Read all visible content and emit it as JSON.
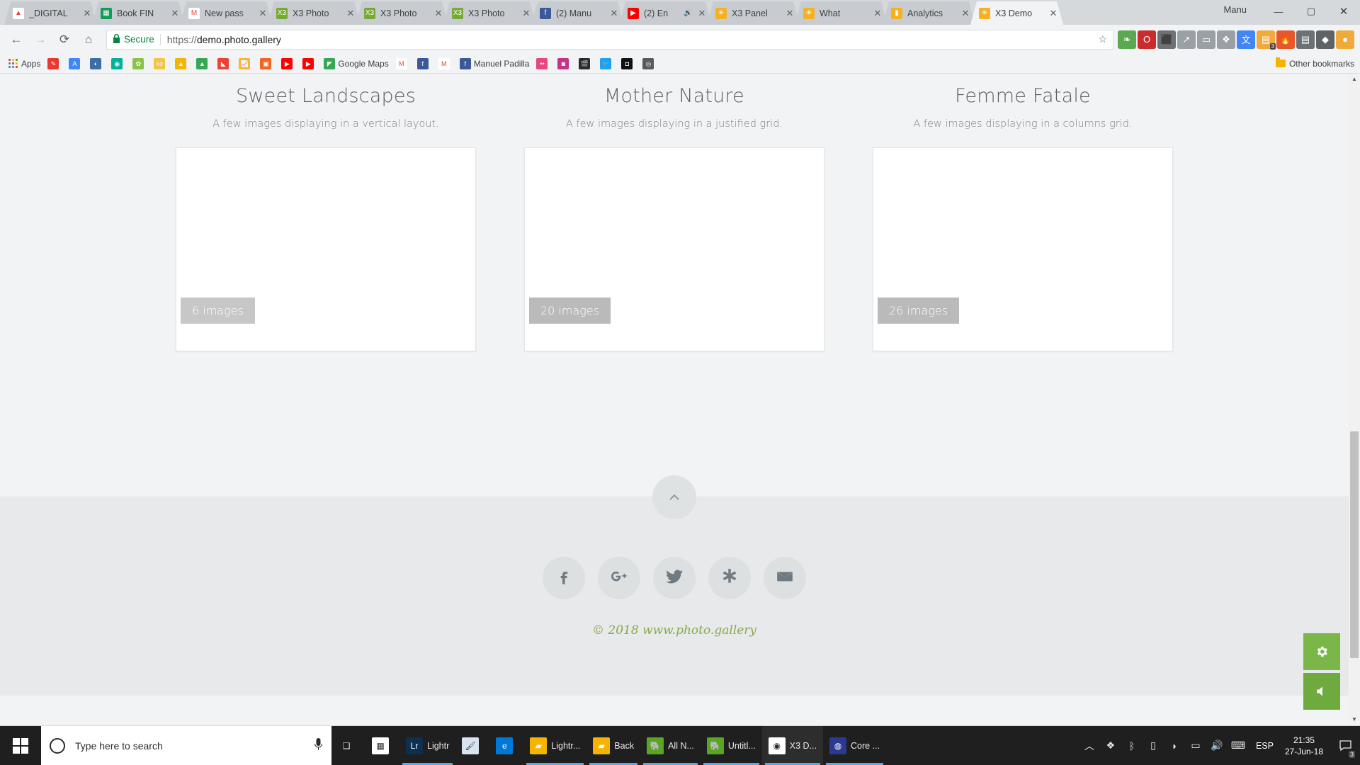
{
  "browser": {
    "tabs": [
      {
        "title": "_DIGITAL",
        "favicon": "drive-icon",
        "color": "#ffffff",
        "glyph": "▲",
        "active": false,
        "audio": false
      },
      {
        "title": "Book FIN",
        "favicon": "sheets-icon",
        "color": "#0f9d58",
        "glyph": "▦",
        "active": false,
        "audio": false
      },
      {
        "title": "New pass",
        "favicon": "gmail-icon",
        "color": "#ffffff",
        "glyph": "M",
        "active": false,
        "audio": false
      },
      {
        "title": "X3 Photo",
        "favicon": "x3-icon",
        "color": "#76a935",
        "glyph": "X3",
        "active": false,
        "audio": false
      },
      {
        "title": "X3 Photo",
        "favicon": "x3-icon",
        "color": "#76a935",
        "glyph": "X3",
        "active": false,
        "audio": false
      },
      {
        "title": "X3 Photo",
        "favicon": "x3-icon",
        "color": "#76a935",
        "glyph": "X3",
        "active": false,
        "audio": false
      },
      {
        "title": "(2) Manu",
        "favicon": "facebook-icon",
        "color": "#3b5998",
        "glyph": "f",
        "active": false,
        "audio": false
      },
      {
        "title": "(2) En",
        "favicon": "youtube-icon",
        "color": "#ff0000",
        "glyph": "▶",
        "active": false,
        "audio": true
      },
      {
        "title": "X3 Panel",
        "favicon": "star-icon",
        "color": "#f5b120",
        "glyph": "✳",
        "active": false,
        "audio": false
      },
      {
        "title": "What",
        "favicon": "star-icon",
        "color": "#f5b120",
        "glyph": "✳",
        "active": false,
        "audio": false
      },
      {
        "title": "Analytics",
        "favicon": "analytics-icon",
        "color": "#f5b120",
        "glyph": "▮",
        "active": false,
        "audio": false
      },
      {
        "title": "X3 Demo",
        "favicon": "star-icon",
        "color": "#f5b120",
        "glyph": "✳",
        "active": true,
        "audio": false
      }
    ],
    "tab_close_label": "✕",
    "tab_audio_label": "🔊",
    "user_chip": "Manu",
    "window_controls": {
      "minimize": "—",
      "maximize": "▢",
      "close": "✕"
    },
    "nav": {
      "back": "←",
      "forward": "→",
      "reload": "⟳",
      "home": "⌂"
    },
    "omnibox": {
      "lock": "🔒",
      "secure_label": "Secure",
      "url_scheme": "https://",
      "url_host": "demo.photo.gallery",
      "bookmark_star": "☆"
    },
    "extensions": [
      {
        "name": "leaf-extension",
        "color": "#5aa84f",
        "glyph": "❧"
      },
      {
        "name": "opera-extension",
        "color": "#cc2b2b",
        "glyph": "O"
      },
      {
        "name": "puzzle-extension",
        "color": "#6d7176",
        "glyph": "⬛"
      },
      {
        "name": "cursor-extension",
        "color": "#9aa0a6",
        "glyph": "↗"
      },
      {
        "name": "window-extension",
        "color": "#9aa0a6",
        "glyph": "▭"
      },
      {
        "name": "dropbox-extension",
        "color": "#9aa0a6",
        "glyph": "❖"
      },
      {
        "name": "translate-extension",
        "color": "#4285f4",
        "glyph": "文"
      },
      {
        "name": "notes-extension",
        "color": "#f2a93b",
        "glyph": "▤",
        "badge": "3"
      },
      {
        "name": "fire-extension",
        "color": "#e8562b",
        "glyph": "🔥"
      },
      {
        "name": "stack-extension",
        "color": "#6d7176",
        "glyph": "▤"
      },
      {
        "name": "drop-extension",
        "color": "#5f6368",
        "glyph": "◆"
      },
      {
        "name": "profile-extension",
        "color": "#f2a93b",
        "glyph": "●"
      }
    ],
    "bookmarks": {
      "apps_label": "Apps",
      "items": [
        {
          "label": "",
          "color": "#e8392f",
          "glyph": "✎"
        },
        {
          "label": "",
          "color": "#4285f4",
          "glyph": "A"
        },
        {
          "label": "",
          "color": "#3a6ea5",
          "glyph": "◐"
        },
        {
          "label": "",
          "color": "#00b398",
          "glyph": "◉"
        },
        {
          "label": "",
          "color": "#8bc34a",
          "glyph": "✿"
        },
        {
          "label": "",
          "color": "#f6c344",
          "glyph": "xe"
        },
        {
          "label": "",
          "color": "#f4b400",
          "glyph": "▲"
        },
        {
          "label": "",
          "color": "#34a853",
          "glyph": "▲"
        },
        {
          "label": "",
          "color": "#ea4335",
          "glyph": "◣"
        },
        {
          "label": "",
          "color": "#f7b733",
          "glyph": "📈"
        },
        {
          "label": "",
          "color": "#f26522",
          "glyph": "▣"
        },
        {
          "label": "",
          "color": "#ff0000",
          "glyph": "▶"
        },
        {
          "label": "",
          "color": "#ff0000",
          "glyph": "▶"
        },
        {
          "label": "Google Maps",
          "color": "#34a853",
          "glyph": "◤"
        },
        {
          "label": "",
          "color": "#ffffff",
          "glyph": "M"
        },
        {
          "label": "",
          "color": "#3b5998",
          "glyph": "f"
        },
        {
          "label": "",
          "color": "#ffffff",
          "glyph": "M"
        },
        {
          "label": "Manuel Padilla",
          "color": "#3b5998",
          "glyph": "f"
        },
        {
          "label": "",
          "color": "#e8467c",
          "glyph": "••"
        },
        {
          "label": "",
          "color": "#c13584",
          "glyph": "◙"
        },
        {
          "label": "",
          "color": "#2b2b2b",
          "glyph": "🎬"
        },
        {
          "label": "",
          "color": "#1da1f2",
          "glyph": "🐦"
        },
        {
          "label": "",
          "color": "#111111",
          "glyph": "◘"
        },
        {
          "label": "",
          "color": "#5a5a5a",
          "glyph": "◎"
        }
      ],
      "other_bookmarks": "Other bookmarks"
    }
  },
  "page": {
    "galleries": [
      {
        "title": "Sweet Landscapes",
        "subtitle": "A few images displaying in a vertical layout.",
        "count_label": "6 images",
        "thumb": "landscape-sunset-photo",
        "badge_style": "dark"
      },
      {
        "title": "Mother Nature",
        "subtitle": "A few images displaying in a justified grid.",
        "count_label": "20 images",
        "thumb": "butterfly-on-daisy-photo",
        "badge_style": "grey"
      },
      {
        "title": "Femme Fatale",
        "subtitle": "A few images displaying in a columns grid.",
        "count_label": "26 images",
        "thumb": "woman-portrait-photo",
        "badge_style": "grey"
      }
    ],
    "footer": {
      "scroll_top_label": "▲",
      "social": [
        {
          "name": "facebook-icon",
          "glyph": "f"
        },
        {
          "name": "google-plus-icon",
          "glyph": "G+"
        },
        {
          "name": "twitter-icon",
          "glyph": "🐦"
        },
        {
          "name": "asterisk-icon",
          "glyph": "✳"
        },
        {
          "name": "email-icon",
          "glyph": "✉"
        }
      ],
      "copyright": "© 2018 www.photo.gallery"
    },
    "side_buttons": [
      {
        "name": "settings-button",
        "glyph": "⚙",
        "color": "#7ab648"
      },
      {
        "name": "volume-button",
        "glyph": "🔈",
        "color": "#6faa3f"
      }
    ]
  },
  "taskbar": {
    "search_placeholder": "Type here to search",
    "mic_icon": "🎤",
    "items": [
      {
        "label": "",
        "name": "task-view-button",
        "color": "transparent",
        "glyph": "❑",
        "state": "idle"
      },
      {
        "label": "",
        "name": "calculator-app",
        "color": "#ffffff",
        "glyph": "▦",
        "state": "idle"
      },
      {
        "label": "Lightr",
        "name": "lightroom-app",
        "color": "#0f2f4f",
        "glyph": "Lr",
        "state": "running"
      },
      {
        "label": "",
        "name": "paint-app",
        "color": "#d8e4ef",
        "glyph": "🖌",
        "state": "idle"
      },
      {
        "label": "",
        "name": "edge-browser",
        "color": "#0078d7",
        "glyph": "e",
        "state": "idle"
      },
      {
        "label": "Lightr...",
        "name": "folder-lightroom",
        "color": "#f4b400",
        "glyph": "▰",
        "state": "running"
      },
      {
        "label": "Back",
        "name": "folder-back",
        "color": "#f4b400",
        "glyph": "▰",
        "state": "running"
      },
      {
        "label": "All N...",
        "name": "evernote-all-notes",
        "color": "#5ba525",
        "glyph": "🐘",
        "state": "running"
      },
      {
        "label": "Untitl...",
        "name": "evernote-untitled",
        "color": "#5ba525",
        "glyph": "🐘",
        "state": "running"
      },
      {
        "label": "X3 D...",
        "name": "chrome-x3-demo",
        "color": "#ffffff",
        "glyph": "◉",
        "state": "open"
      },
      {
        "label": "Core ...",
        "name": "core-app",
        "color": "#2b3a8f",
        "glyph": "◍",
        "state": "running"
      }
    ],
    "tray": [
      {
        "name": "show-hidden-icons",
        "glyph": "︿"
      },
      {
        "name": "dropbox-tray-icon",
        "glyph": "❖"
      },
      {
        "name": "bluetooth-tray-icon",
        "glyph": "ᛒ"
      },
      {
        "name": "battery-tray-icon",
        "glyph": "▯"
      },
      {
        "name": "wifi-tray-icon",
        "glyph": "◗"
      },
      {
        "name": "power-tray-icon",
        "glyph": "▭"
      },
      {
        "name": "volume-tray-icon",
        "glyph": "🔊"
      },
      {
        "name": "keyboard-tray-icon",
        "glyph": "⌨"
      }
    ],
    "language": "ESP",
    "clock_time": "21:35",
    "clock_date": "27-Jun-18",
    "notification_count": "3"
  }
}
